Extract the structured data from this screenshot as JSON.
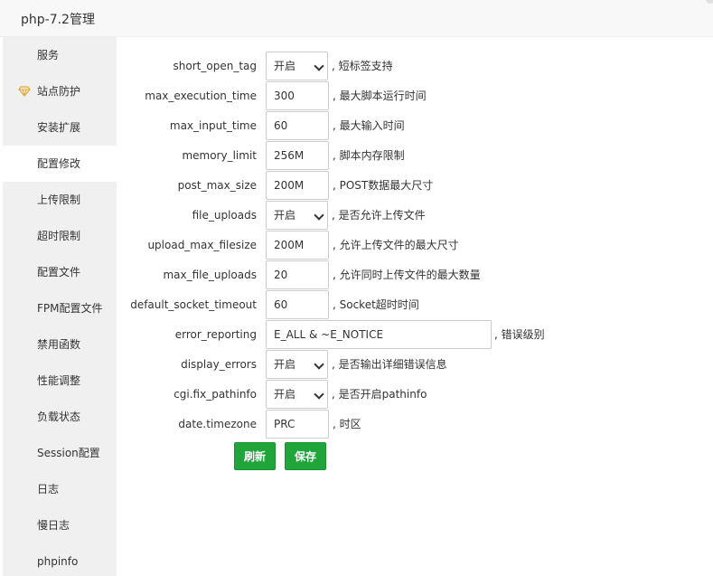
{
  "dialog": {
    "title": "php-7.2管理"
  },
  "sidebar": {
    "items": [
      {
        "label": "服务"
      },
      {
        "label": "站点防护"
      },
      {
        "label": "安装扩展"
      },
      {
        "label": "配置修改"
      },
      {
        "label": "上传限制"
      },
      {
        "label": "超时限制"
      },
      {
        "label": "配置文件"
      },
      {
        "label": "FPM配置文件"
      },
      {
        "label": "禁用函数"
      },
      {
        "label": "性能调整"
      },
      {
        "label": "负载状态"
      },
      {
        "label": "Session配置"
      },
      {
        "label": "日志"
      },
      {
        "label": "慢日志"
      },
      {
        "label": "phpinfo"
      }
    ],
    "active_item": "配置修改"
  },
  "form": {
    "fields": [
      {
        "label": "short_open_tag",
        "value": "开启",
        "desc": ", 短标签支持"
      },
      {
        "label": "max_execution_time",
        "value": "300",
        "desc": ", 最大脚本运行时间"
      },
      {
        "label": "max_input_time",
        "value": "60",
        "desc": ", 最大输入时间"
      },
      {
        "label": "memory_limit",
        "value": "256M",
        "desc": ", 脚本内存限制"
      },
      {
        "label": "post_max_size",
        "value": "200M",
        "desc": ", POST数据最大尺寸"
      },
      {
        "label": "file_uploads",
        "value": "开启",
        "desc": ", 是否允许上传文件"
      },
      {
        "label": "upload_max_filesize",
        "value": "200M",
        "desc": ", 允许上传文件的最大尺寸"
      },
      {
        "label": "max_file_uploads",
        "value": "20",
        "desc": ", 允许同时上传文件的最大数量"
      },
      {
        "label": "default_socket_timeout",
        "value": "60",
        "desc": ", Socket超时时间"
      },
      {
        "label": "error_reporting",
        "value": "E_ALL & ~E_NOTICE",
        "desc": ", 错误级别"
      },
      {
        "label": "display_errors",
        "value": "开启",
        "desc": ", 是否输出详细错误信息"
      },
      {
        "label": "cgi.fix_pathinfo",
        "value": "开启",
        "desc": ", 是否开启pathinfo"
      },
      {
        "label": "date.timezone",
        "value": "PRC",
        "desc": ", 时区"
      }
    ]
  },
  "buttons": {
    "refresh": "刷新",
    "save": "保存"
  },
  "colors": {
    "primary": "#20a53a",
    "sidebar_bg": "#f0f0f0",
    "header_bg": "#f8f8f8"
  }
}
